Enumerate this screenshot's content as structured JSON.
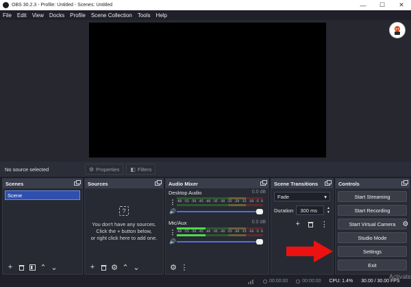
{
  "window": {
    "title": "OBS 30.2.3 - Profile: Untitled - Scenes: Untitled"
  },
  "window_controls": {
    "minimize": "—",
    "maximize": "☐",
    "close": "✕"
  },
  "menu": [
    "File",
    "Edit",
    "View",
    "Docks",
    "Profile",
    "Scene Collection",
    "Tools",
    "Help"
  ],
  "source_toolbar": {
    "no_source": "No source selected",
    "properties": "Properties",
    "filters": "Filters"
  },
  "docks": {
    "scenes": {
      "title": "Scenes",
      "items": [
        "Scene"
      ]
    },
    "sources": {
      "title": "Sources",
      "empty_line1": "You don't have any sources.",
      "empty_line2": "Click the + button below,",
      "empty_line3": "or right click here to add one."
    },
    "audio_mixer": {
      "title": "Audio Mixer",
      "scale": [
        "-60",
        "-55",
        "-50",
        "-45",
        "-40",
        "-35",
        "-30",
        "-25",
        "-20",
        "-15",
        "-10",
        "-5",
        "0"
      ],
      "channels": [
        {
          "name": "Desktop Audio",
          "db": "0.0 dB",
          "level": 0.0
        },
        {
          "name": "Mic/Aux",
          "db": "0.0 dB",
          "level": 0.33
        }
      ]
    },
    "scene_transitions": {
      "title": "Scene Transitions",
      "transition": "Fade",
      "duration_label": "Duration",
      "duration_value": "300 ms"
    },
    "controls": {
      "title": "Controls",
      "buttons": [
        "Start Streaming",
        "Start Recording",
        "Start Virtual Camera",
        "Studio Mode",
        "Settings",
        "Exit"
      ]
    }
  },
  "status_bar": {
    "time1": "00:00:00",
    "time2": "00:00:00",
    "cpu": "CPU: 1.4%",
    "fps": "30.00 / 30.00 FPS"
  },
  "watermark": "Activate",
  "colors": {
    "accent": "#2e4fae",
    "arrow": "#ee1111",
    "meter_green": "#4ddc4b"
  },
  "icons": {
    "gear": "gear-icon",
    "arrow": "red-arrow-icon"
  }
}
